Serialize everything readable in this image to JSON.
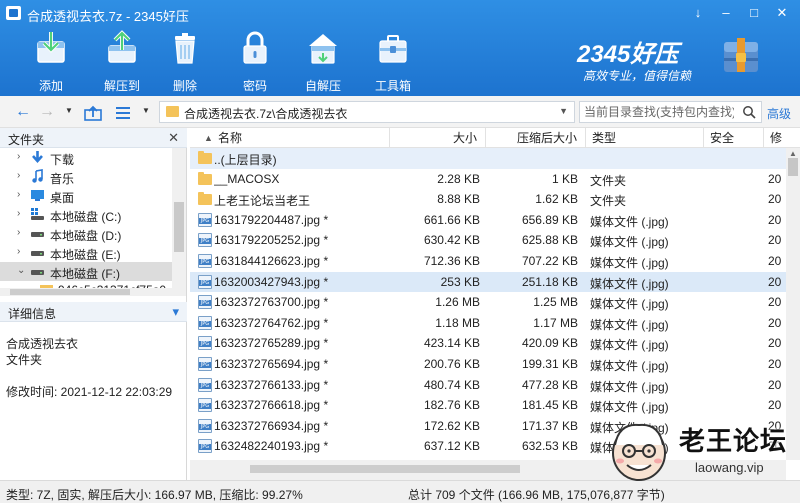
{
  "window": {
    "title": "合成透视去衣.7z - 2345好压",
    "controls": [
      "↓",
      "–",
      "□",
      "✕"
    ]
  },
  "toolbar": {
    "items": [
      {
        "label": "添加",
        "icon": "add-icon"
      },
      {
        "label": "解压到",
        "icon": "extract-icon"
      },
      {
        "label": "删除",
        "icon": "delete-icon"
      },
      {
        "label": "密码",
        "icon": "password-icon"
      },
      {
        "label": "自解压",
        "icon": "self-extract-icon"
      },
      {
        "label": "工具箱",
        "icon": "toolbox-icon"
      }
    ]
  },
  "brand": {
    "name": "2345好压",
    "slogan": "高效专业，值得信赖"
  },
  "address": {
    "path": "合成透视去衣.7z\\合成透视去衣",
    "search_placeholder": "当前目录查找(支持包内查找)",
    "advanced": "高级"
  },
  "folders_pane": {
    "title": "文件夹",
    "close": "✕",
    "items": [
      {
        "label": "下载",
        "icon": "download-folder-icon",
        "arrow": "›"
      },
      {
        "label": "音乐",
        "icon": "music-folder-icon",
        "arrow": "›"
      },
      {
        "label": "桌面",
        "icon": "desktop-folder-icon",
        "arrow": "›"
      },
      {
        "label": "本地磁盘 (C:)",
        "icon": "drive-icon",
        "arrow": "›"
      },
      {
        "label": "本地磁盘 (D:)",
        "icon": "drive-icon",
        "arrow": "›"
      },
      {
        "label": "本地磁盘 (E:)",
        "icon": "drive-icon",
        "arrow": "›"
      },
      {
        "label": "本地磁盘 (F:)",
        "icon": "drive-icon",
        "arrow": "⌄"
      },
      {
        "label": "946c5c31371cf75a0",
        "icon": "folder-icon",
        "arrow": ""
      }
    ]
  },
  "details_pane": {
    "title": "详细信息",
    "toggle": "▾",
    "name": "合成透视去衣",
    "kind": "文件夹",
    "modified": "修改时间:  2021-12-12 22:03:29"
  },
  "file_list": {
    "columns": {
      "name": "名称",
      "size": "大小",
      "packed": "压缩后大小",
      "type": "类型",
      "security": "安全",
      "modified": "修"
    },
    "sort_arrow": "▲",
    "rows": [
      {
        "name": "..(上层目录)",
        "size": "",
        "packed": "",
        "type": "",
        "mod": "",
        "icon": "folder"
      },
      {
        "name": "__MACOSX",
        "size": "2.28 KB",
        "packed": "1 KB",
        "type": "文件夹",
        "mod": "20",
        "icon": "folder"
      },
      {
        "name": "上老王论坛当老王",
        "size": "8.88 KB",
        "packed": "1.62 KB",
        "type": "文件夹",
        "mod": "20",
        "icon": "folder"
      },
      {
        "name": "1631792204487.jpg *",
        "size": "661.66 KB",
        "packed": "656.89 KB",
        "type": "媒体文件 (.jpg)",
        "mod": "20",
        "icon": "jpg"
      },
      {
        "name": "1631792205252.jpg *",
        "size": "630.42 KB",
        "packed": "625.88 KB",
        "type": "媒体文件 (.jpg)",
        "mod": "20",
        "icon": "jpg"
      },
      {
        "name": "1631844126623.jpg *",
        "size": "712.36 KB",
        "packed": "707.22 KB",
        "type": "媒体文件 (.jpg)",
        "mod": "20",
        "icon": "jpg"
      },
      {
        "name": "1632003427943.jpg *",
        "size": "253 KB",
        "packed": "251.18 KB",
        "type": "媒体文件 (.jpg)",
        "mod": "20",
        "icon": "jpg"
      },
      {
        "name": "1632372763700.jpg *",
        "size": "1.26 MB",
        "packed": "1.25 MB",
        "type": "媒体文件 (.jpg)",
        "mod": "20",
        "icon": "jpg"
      },
      {
        "name": "1632372764762.jpg *",
        "size": "1.18 MB",
        "packed": "1.17 MB",
        "type": "媒体文件 (.jpg)",
        "mod": "20",
        "icon": "jpg"
      },
      {
        "name": "1632372765289.jpg *",
        "size": "423.14 KB",
        "packed": "420.09 KB",
        "type": "媒体文件 (.jpg)",
        "mod": "20",
        "icon": "jpg"
      },
      {
        "name": "1632372765694.jpg *",
        "size": "200.76 KB",
        "packed": "199.31 KB",
        "type": "媒体文件 (.jpg)",
        "mod": "20",
        "icon": "jpg"
      },
      {
        "name": "1632372766133.jpg *",
        "size": "480.74 KB",
        "packed": "477.28 KB",
        "type": "媒体文件 (.jpg)",
        "mod": "20",
        "icon": "jpg"
      },
      {
        "name": "1632372766618.jpg *",
        "size": "182.76 KB",
        "packed": "181.45 KB",
        "type": "媒体文件 (.jpg)",
        "mod": "20",
        "icon": "jpg"
      },
      {
        "name": "1632372766934.jpg *",
        "size": "172.62 KB",
        "packed": "171.37 KB",
        "type": "媒体文件 (.jpg)",
        "mod": "20",
        "icon": "jpg"
      },
      {
        "name": "1632482240193.jpg *",
        "size": "637.12 KB",
        "packed": "632.53 KB",
        "type": "媒体文件 (.jpg)",
        "mod": "20",
        "icon": "jpg"
      }
    ],
    "highlighted_rows": [
      0,
      6
    ]
  },
  "status": {
    "left": "类型: 7Z, 固实, 解压后大小: 166.97 MB, 压缩比: 99.27%",
    "right": "总计 709 个文件 (166.96 MB, 175,076,877 字节)"
  },
  "watermark": {
    "name": "老王论坛",
    "url": "laowang.vip"
  },
  "colors": {
    "header_top": "#2f8fe4",
    "header_bottom": "#1d73cf",
    "accent": "#2b79d6",
    "folder": "#f4c35a",
    "row_highlight": "#dbe9f8"
  }
}
